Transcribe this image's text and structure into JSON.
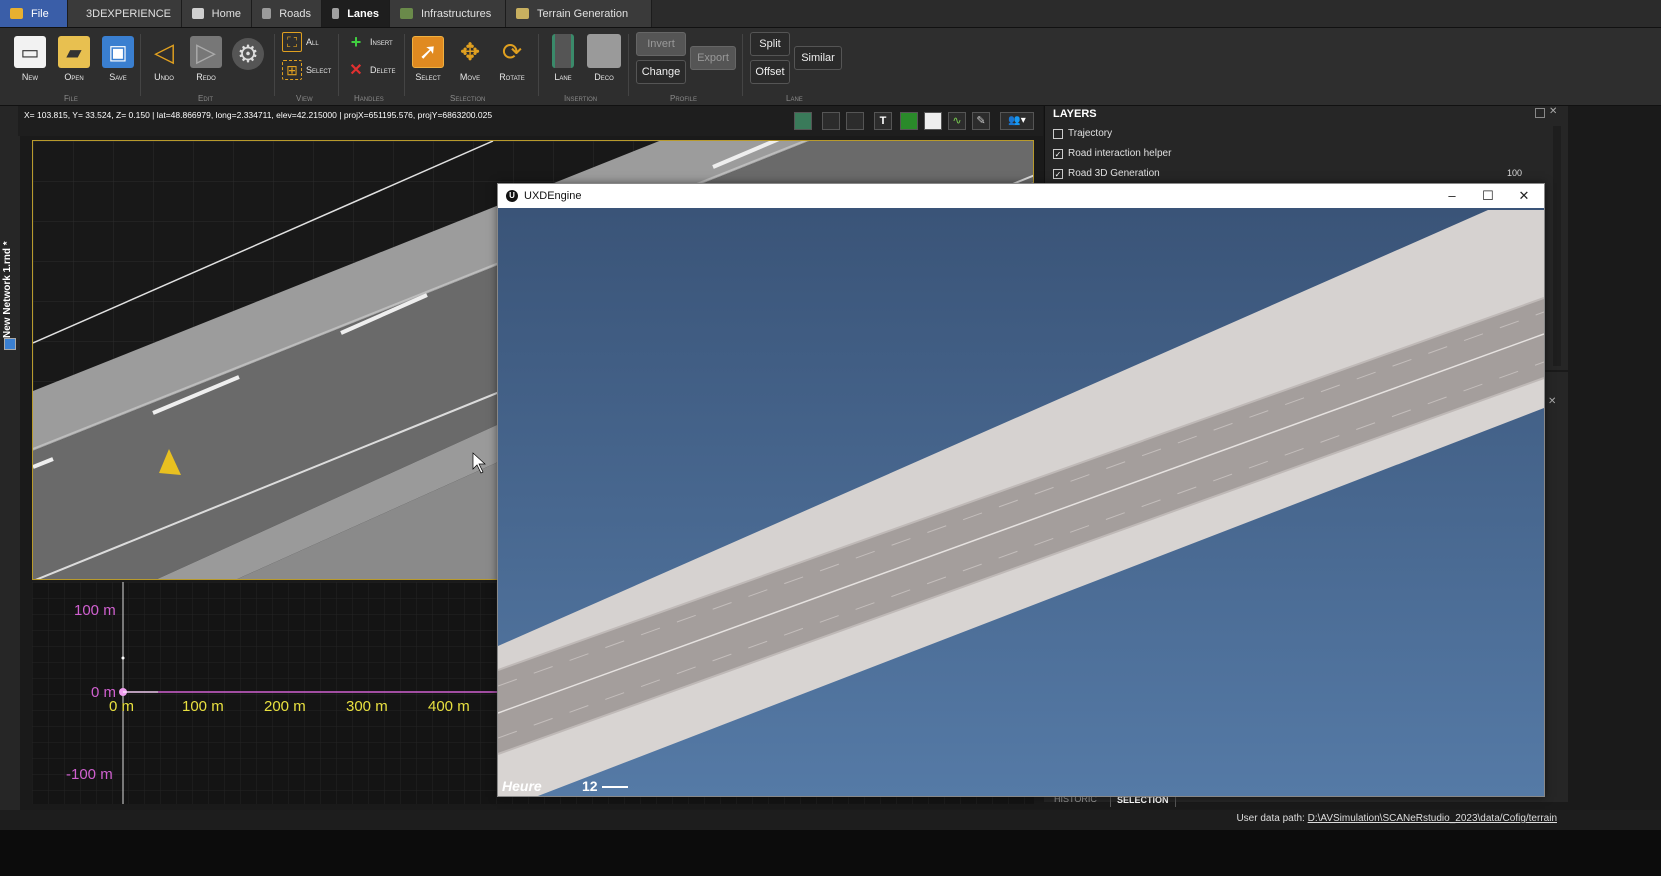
{
  "tabs": [
    {
      "label": "File",
      "icon": "folder-icon",
      "color": "#3a5ea8"
    },
    {
      "label": "3DEXPERIENCE",
      "icon": "globe-icon"
    },
    {
      "label": "Home",
      "icon": "home-icon"
    },
    {
      "label": "Roads",
      "icon": "road-icon"
    },
    {
      "label": "Lanes",
      "icon": "lanes-icon",
      "active": true
    },
    {
      "label": "Infrastructures",
      "icon": "infrastructure-icon"
    },
    {
      "label": "Terrain Generation",
      "icon": "terrain-icon"
    }
  ],
  "ribbon": {
    "file": {
      "group": "File",
      "new": "New",
      "open": "Open",
      "save": "Save"
    },
    "edit": {
      "group": "Edit",
      "undo": "Undo",
      "redo": "Redo"
    },
    "view": {
      "group": "View",
      "all": "All",
      "select": "Select"
    },
    "handles": {
      "group": "Handles",
      "insert": "Insert",
      "delete": "Delete"
    },
    "selection": {
      "group": "Selection",
      "select": "Select",
      "move": "Move",
      "rotate": "Rotate"
    },
    "insertion": {
      "group": "Insertion",
      "lane": "Lane",
      "deco": "Deco"
    },
    "profile": {
      "group": "Profile",
      "invert": "Invert",
      "export": "Export",
      "change": "Change"
    },
    "lane": {
      "group": "Lane",
      "split": "Split",
      "similar": "Similar",
      "offset": "Offset"
    }
  },
  "coords": "X= 103.815, Y= 33.524, Z= 0.150 | lat=48.866979, long=2.334711, elev=42.215000 | projX=651195.576, projY=6863200.025",
  "network_title": "New Network 1.rnd *",
  "profile": {
    "y_labels": [
      "100 m",
      "0 m",
      "-100 m"
    ],
    "x_labels": [
      "0 m",
      "100 m",
      "200 m",
      "300 m",
      "400 m"
    ]
  },
  "layers": {
    "title": "LAYERS",
    "items": [
      {
        "label": "Trajectory",
        "checked": false
      },
      {
        "label": "Road interaction helper",
        "checked": true
      },
      {
        "label": "Road 3D Generation",
        "checked": true
      }
    ],
    "value": "100"
  },
  "bottom_tabs": [
    "HISTORIC",
    "SELECTION"
  ],
  "status": {
    "user_label": "User data path:",
    "user_path": "D:\\AVSimulation\\SCANeRstudio_2023\\data/Cofig/terrain"
  },
  "uxd": {
    "title": "UXDEngine",
    "hud_heure": "Heure",
    "hud_num": "12"
  },
  "colors": {
    "accent": "#3a5ea8",
    "viewport_border": "#b89a2c",
    "profile_axis": "#d060d0",
    "profile_labels": "#e8e040"
  }
}
